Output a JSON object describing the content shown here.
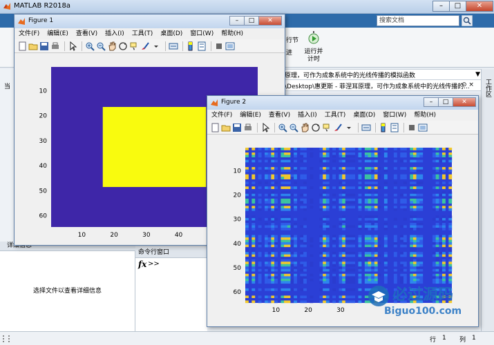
{
  "app": {
    "title": "MATLAB R2018a",
    "window_controls": {
      "minimize": "–",
      "maximize": "□",
      "close": "✕"
    },
    "search_placeholder": "搜索文档",
    "run_section": "运行并\n计时",
    "run_left_label": "行节",
    "run_left_label2": "进",
    "address_path": "原理，可作为成象系统中的光线传播的模拟函数",
    "address_path2": "\\Desktop\\惠更斯 - 菲涅耳原理，可作为成象系统中的光线传播的...",
    "workspace_vtab": "工作区",
    "left_vtab": "当",
    "details_header": "详细信息",
    "details_message": "选择文件以查看详细信息",
    "cmd_header": "命令行窗口",
    "cmd_fx": "fx",
    "cmd_prompt": ">>",
    "status_row_label": "行",
    "status_row": "1",
    "status_col_label": "列",
    "status_col": "1"
  },
  "menus": [
    "文件(F)",
    "编辑(E)",
    "查看(V)",
    "插入(I)",
    "工具(T)",
    "桌面(D)",
    "窗口(W)",
    "帮助(H)"
  ],
  "colors": {
    "parula_dark": "#3e26a8",
    "parula_yellow": "#f9fb0e",
    "ribbon_blue": "#2e6baa"
  },
  "figure1": {
    "title": "Figure 1",
    "yticks": [
      "10",
      "20",
      "30",
      "40",
      "50",
      "60"
    ],
    "xticks": [
      "10",
      "20",
      "30",
      "40"
    ],
    "image": {
      "type": "heatmap",
      "background_value": 0,
      "rect_value": 1,
      "rect": {
        "x0": 16,
        "x1": 48,
        "y0": 16,
        "y1": 48
      },
      "size": [
        64,
        64
      ]
    }
  },
  "figure2": {
    "title": "Figure 2",
    "yticks": [
      "10",
      "20",
      "30",
      "40",
      "50",
      "60"
    ],
    "xticks": [
      "10",
      "20",
      "30"
    ]
  },
  "watermark": {
    "line1": "必过源码",
    "line2": "Biguo100.com"
  }
}
